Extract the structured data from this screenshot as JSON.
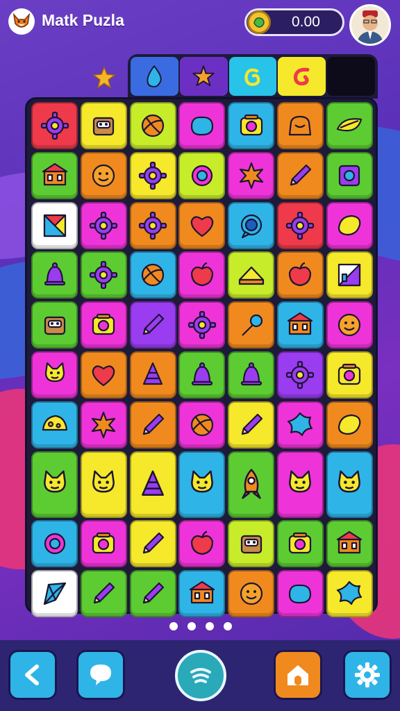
{
  "header": {
    "app_title": "Matk Puzla",
    "coin_value": "0.00",
    "logo_icon": "fox-icon",
    "avatar_icon": "player-avatar"
  },
  "tabs": [
    {
      "name": "star",
      "icon": "star-icon",
      "color": "#f4b728"
    },
    {
      "name": "drop",
      "icon": "drop-icon",
      "color": "#3a6be0"
    },
    {
      "name": "starfish",
      "icon": "starfish-icon",
      "color": "#6c2fc4"
    },
    {
      "name": "swirl",
      "icon": "swirl-icon",
      "color": "#27c3e8"
    },
    {
      "name": "spiral",
      "icon": "spiral-icon",
      "color": "#f6e82a"
    },
    {
      "name": "empty",
      "icon": "",
      "color": "#0d0b1a"
    }
  ],
  "board": {
    "rows": [
      [
        {
          "icon": "gear",
          "bg": "#ee3a4a"
        },
        {
          "icon": "box",
          "bg": "#f6e82a"
        },
        {
          "icon": "ball",
          "bg": "#c7ec2a"
        },
        {
          "icon": "blob",
          "bg": "#ee34d8"
        },
        {
          "icon": "radio",
          "bg": "#2fb4e8"
        },
        {
          "icon": "bag",
          "bg": "#f08a1e"
        },
        {
          "icon": "leaf",
          "bg": "#5ccc32"
        }
      ],
      [
        {
          "icon": "house",
          "bg": "#5ccc32"
        },
        {
          "icon": "face",
          "bg": "#f08a1e"
        },
        {
          "icon": "gear",
          "bg": "#f6e82a"
        },
        {
          "icon": "ring",
          "bg": "#c7ec2a"
        },
        {
          "icon": "burst",
          "bg": "#ee34d8"
        },
        {
          "icon": "pencil",
          "bg": "#f08a1e"
        },
        {
          "icon": "safe",
          "bg": "#5ccc32"
        }
      ],
      [
        {
          "icon": "prism",
          "bg": "#ffffff"
        },
        {
          "icon": "gear",
          "bg": "#ee34d8"
        },
        {
          "icon": "gear",
          "bg": "#f08a1e"
        },
        {
          "icon": "heart",
          "bg": "#f08a1e"
        },
        {
          "icon": "bubble",
          "bg": "#2fb4e8"
        },
        {
          "icon": "gear",
          "bg": "#ee3a4a"
        },
        {
          "icon": "lemon",
          "bg": "#ee34d8"
        }
      ],
      [
        {
          "icon": "bell",
          "bg": "#5ccc32"
        },
        {
          "icon": "gear",
          "bg": "#5ccc32"
        },
        {
          "icon": "ball",
          "bg": "#2fb4e8"
        },
        {
          "icon": "apple",
          "bg": "#ee34d8"
        },
        {
          "icon": "cake",
          "bg": "#c7ec2a"
        },
        {
          "icon": "apple",
          "bg": "#f08a1e"
        },
        {
          "icon": "chart",
          "bg": "#f6e82a"
        }
      ],
      [
        {
          "icon": "box",
          "bg": "#5ccc32"
        },
        {
          "icon": "radio",
          "bg": "#ee34d8"
        },
        {
          "icon": "pencil",
          "bg": "#9a3cf0"
        },
        {
          "icon": "gear",
          "bg": "#ee34d8"
        },
        {
          "icon": "brush",
          "bg": "#f08a1e"
        },
        {
          "icon": "house",
          "bg": "#2fb4e8"
        },
        {
          "icon": "face",
          "bg": "#ee34d8"
        }
      ],
      [
        {
          "icon": "cat",
          "bg": "#ee34d8"
        },
        {
          "icon": "heart",
          "bg": "#f08a1e"
        },
        {
          "icon": "cone",
          "bg": "#f08a1e"
        },
        {
          "icon": "bell",
          "bg": "#5ccc32"
        },
        {
          "icon": "bell",
          "bg": "#5ccc32"
        },
        {
          "icon": "gear",
          "bg": "#9a3cf0"
        },
        {
          "icon": "radio",
          "bg": "#f6e82a"
        }
      ],
      [
        {
          "icon": "cheese",
          "bg": "#2fb4e8"
        },
        {
          "icon": "burst",
          "bg": "#ee34d8"
        },
        {
          "icon": "pencil",
          "bg": "#f08a1e"
        },
        {
          "icon": "ball",
          "bg": "#ee34d8"
        },
        {
          "icon": "pencil",
          "bg": "#f6e82a"
        },
        {
          "icon": "splat",
          "bg": "#ee34d8"
        },
        {
          "icon": "lemon",
          "bg": "#f08a1e"
        }
      ],
      [
        {
          "icon": "cat",
          "bg": "#5ccc32",
          "tall": true
        },
        {
          "icon": "cat",
          "bg": "#f6e82a",
          "tall": true
        },
        {
          "icon": "cone",
          "bg": "#f6e82a",
          "tall": true
        },
        {
          "icon": "cat",
          "bg": "#2fb4e8",
          "tall": true
        },
        {
          "icon": "rocket",
          "bg": "#5ccc32",
          "tall": true
        },
        {
          "icon": "cat",
          "bg": "#ee34d8",
          "tall": true
        },
        {
          "icon": "cat",
          "bg": "#2fb4e8",
          "tall": true
        }
      ],
      [
        {
          "icon": "ring",
          "bg": "#2fb4e8"
        },
        {
          "icon": "radio",
          "bg": "#ee34d8"
        },
        {
          "icon": "pencil",
          "bg": "#f6e82a"
        },
        {
          "icon": "apple",
          "bg": "#ee34d8"
        },
        {
          "icon": "box",
          "bg": "#c7ec2a"
        },
        {
          "icon": "radio",
          "bg": "#5ccc32"
        },
        {
          "icon": "house",
          "bg": "#5ccc32"
        }
      ],
      [
        {
          "icon": "kite",
          "bg": "#ffffff"
        },
        {
          "icon": "pencil",
          "bg": "#5ccc32"
        },
        {
          "icon": "pencil",
          "bg": "#5ccc32"
        },
        {
          "icon": "house",
          "bg": "#2fb4e8"
        },
        {
          "icon": "face",
          "bg": "#f08a1e"
        },
        {
          "icon": "blob",
          "bg": "#ee34d8"
        },
        {
          "icon": "splat",
          "bg": "#f6e82a"
        }
      ]
    ]
  },
  "pager": {
    "count": 4
  },
  "bottom_nav": [
    {
      "name": "back",
      "icon": "back-arrow-icon"
    },
    {
      "name": "chat",
      "icon": "chat-bubble-icon"
    },
    {
      "name": "center",
      "icon": "wifi-waves-icon"
    },
    {
      "name": "home",
      "icon": "home-icon"
    },
    {
      "name": "settings",
      "icon": "gear-icon"
    }
  ]
}
